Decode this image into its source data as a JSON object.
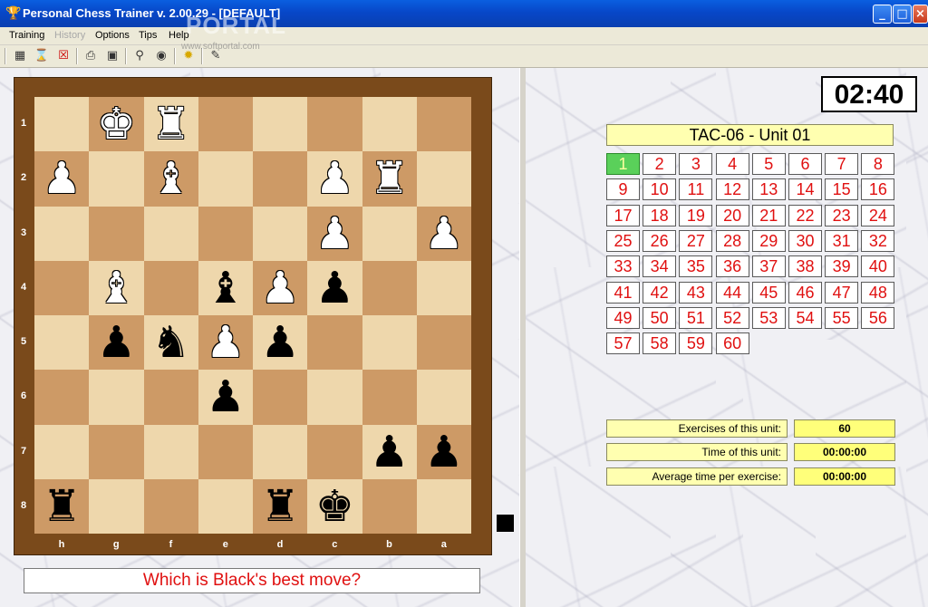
{
  "window": {
    "title": "Personal Chess Trainer v. 2.00.29 - [DEFAULT]"
  },
  "watermark": {
    "text": "PORTAL",
    "sub": "www.softportal.com"
  },
  "menu": [
    {
      "id": "training",
      "label": "Training",
      "enabled": true
    },
    {
      "id": "history",
      "label": "History",
      "enabled": false
    },
    {
      "id": "options",
      "label": "Options",
      "enabled": true
    },
    {
      "id": "tips",
      "label": "Tips",
      "enabled": true
    },
    {
      "id": "help",
      "label": "Help",
      "enabled": true
    }
  ],
  "toolbar": [
    "board-icon",
    "hourglass-icon",
    "cancel-icon",
    "print-icon",
    "save-icon",
    "search-icon",
    "camera-icon",
    "bulb-icon",
    "notes-icon"
  ],
  "board": {
    "ranks": [
      "1",
      "2",
      "3",
      "4",
      "5",
      "6",
      "7",
      "8"
    ],
    "files": [
      "h",
      "g",
      "f",
      "e",
      "d",
      "c",
      "b",
      "a"
    ],
    "pieces": [
      {
        "square": "g1",
        "glyph": "♚",
        "color": "w"
      },
      {
        "square": "f1",
        "glyph": "♜",
        "color": "w"
      },
      {
        "square": "h2",
        "glyph": "♟",
        "color": "w"
      },
      {
        "square": "f2",
        "glyph": "♝",
        "color": "w"
      },
      {
        "square": "c2",
        "glyph": "♟",
        "color": "w"
      },
      {
        "square": "b2",
        "glyph": "♜",
        "color": "w"
      },
      {
        "square": "c3",
        "glyph": "♟",
        "color": "w"
      },
      {
        "square": "a3",
        "glyph": "♟",
        "color": "w"
      },
      {
        "square": "g4",
        "glyph": "♝",
        "color": "w"
      },
      {
        "square": "e4",
        "glyph": "♝",
        "color": "b"
      },
      {
        "square": "d4",
        "glyph": "♟",
        "color": "w"
      },
      {
        "square": "c4",
        "glyph": "♟",
        "color": "b"
      },
      {
        "square": "g5",
        "glyph": "♟",
        "color": "b"
      },
      {
        "square": "f5",
        "glyph": "♞",
        "color": "b"
      },
      {
        "square": "e5",
        "glyph": "♟",
        "color": "w"
      },
      {
        "square": "d5",
        "glyph": "♟",
        "color": "b"
      },
      {
        "square": "e6",
        "glyph": "♟",
        "color": "b"
      },
      {
        "square": "b7",
        "glyph": "♟",
        "color": "b"
      },
      {
        "square": "a7",
        "glyph": "♟",
        "color": "b"
      },
      {
        "square": "h8",
        "glyph": "♜",
        "color": "b"
      },
      {
        "square": "d8",
        "glyph": "♜",
        "color": "b"
      },
      {
        "square": "c8",
        "glyph": "♚",
        "color": "b"
      }
    ],
    "side_to_move_color": "#000000"
  },
  "question": "Which is Black's best move?",
  "timer": "02:40",
  "unit": {
    "title": "TAC-06  -  Unit 01",
    "current_exercise": 1,
    "exercise_count": 60
  },
  "exercises": [
    "1",
    "2",
    "3",
    "4",
    "5",
    "6",
    "7",
    "8",
    "9",
    "10",
    "11",
    "12",
    "13",
    "14",
    "15",
    "16",
    "17",
    "18",
    "19",
    "20",
    "21",
    "22",
    "23",
    "24",
    "25",
    "26",
    "27",
    "28",
    "29",
    "30",
    "31",
    "32",
    "33",
    "34",
    "35",
    "36",
    "37",
    "38",
    "39",
    "40",
    "41",
    "42",
    "43",
    "44",
    "45",
    "46",
    "47",
    "48",
    "49",
    "50",
    "51",
    "52",
    "53",
    "54",
    "55",
    "56",
    "57",
    "58",
    "59",
    "60"
  ],
  "stats": {
    "exercises_label": "Exercises of this unit:",
    "exercises_value": "60",
    "time_label": "Time of this unit:",
    "time_value": "00:00:00",
    "avg_label": "Average time per exercise:",
    "avg_value": "00:00:00"
  },
  "colors": {
    "question_text": "#e01010",
    "current_exercise": "#5ad05a",
    "panel_yellow": "#ffffb0"
  }
}
